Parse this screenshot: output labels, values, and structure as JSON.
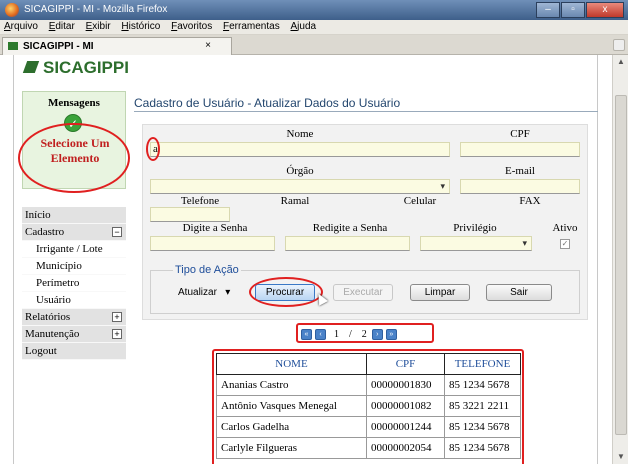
{
  "window": {
    "title": "SICAGIPPI - MI - Mozilla Firefox",
    "buttons": [
      "–",
      "▫",
      "x"
    ]
  },
  "menubar": [
    "Arquivo",
    "Editar",
    "Exibir",
    "Histórico",
    "Favoritos",
    "Ferramentas",
    "Ajuda"
  ],
  "tab": {
    "label": "SICAGIPPI - MI",
    "close": "×"
  },
  "app": {
    "logo": "SICAGIPPI"
  },
  "messages": {
    "title": "Mensagens",
    "text_line1": "Selecione Um",
    "text_line2": "Elemento",
    "check": "✓"
  },
  "nav": {
    "inicio": "Início",
    "cadastro": "Cadastro",
    "cadastro_toggle": "−",
    "sub": [
      "Irrigante / Lote",
      "Município",
      "Perímetro",
      "Usuário"
    ],
    "relatorios": "Relatórios",
    "manutencao": "Manutenção",
    "expand": "+",
    "logout": "Logout"
  },
  "page": {
    "title": "Cadastro de Usuário - Atualizar Dados do Usuário"
  },
  "form": {
    "nome_label": "Nome",
    "nome_value": "a",
    "cpf_label": "CPF",
    "orgao_label": "Órgão",
    "email_label": "E-mail",
    "telefone_label": "Telefone",
    "ramal_label": "Ramal",
    "celular_label": "Celular",
    "fax_label": "FAX",
    "senha_label": "Digite a Senha",
    "redigite_label": "Redigite a Senha",
    "privilegio_label": "Privilégio",
    "ativo_label": "Ativo",
    "ativo_check": "✓"
  },
  "acao": {
    "legend": "Tipo de Ação",
    "select_value": "Atualizar",
    "select_arrow": "▾",
    "procurar": "Procurar",
    "executar": "Executar",
    "limpar": "Limpar",
    "sair": "Sair"
  },
  "pager": {
    "first": "«",
    "prev": "‹",
    "current": "1",
    "sep": "/",
    "total": "2",
    "next": "›",
    "last": "»"
  },
  "table": {
    "headers": [
      "NOME",
      "CPF",
      "TELEFONE"
    ],
    "rows": [
      [
        "Ananias Castro",
        "00000001830",
        "85 1234 5678"
      ],
      [
        "Antônio Vasques Menegal",
        "00000001082",
        "85 3221 2211"
      ],
      [
        "Carlos Gadelha",
        "00000001244",
        "85 1234 5678"
      ],
      [
        "Carlyle Filgueras",
        "00000002054",
        "85 1234 5678"
      ]
    ]
  },
  "colors": {
    "accent_red": "#e02020",
    "logo_green": "#2d6e2d",
    "title_blue": "#23466e",
    "link_blue": "#1f4e9a"
  }
}
